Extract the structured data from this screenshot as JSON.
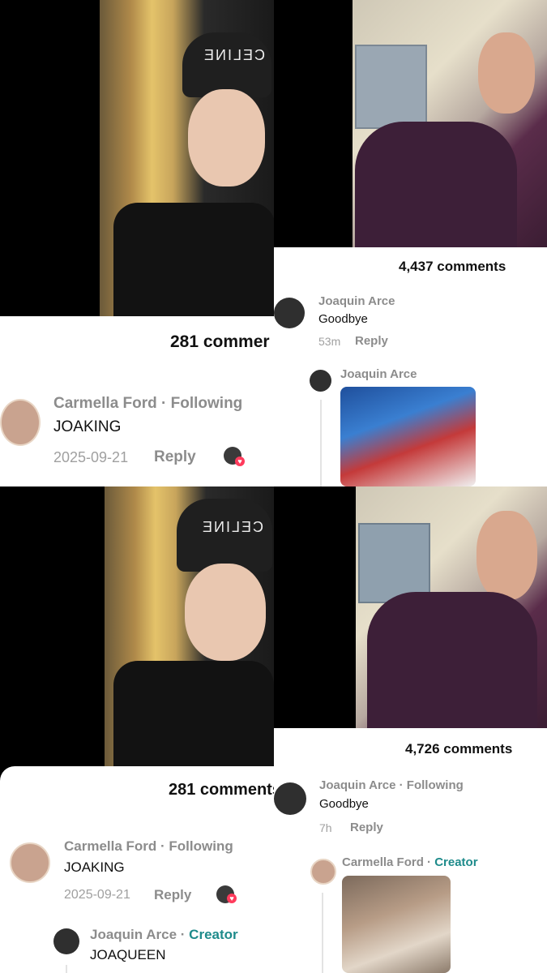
{
  "top_left": {
    "comments_count": "281 commer",
    "comment": {
      "author": "Carmella Ford · Following",
      "text": "JOAKING",
      "date": "2025-09-21",
      "reply_label": "Reply"
    }
  },
  "top_right": {
    "comments_count": "4,437 comments",
    "comment": {
      "author": "Joaquin Arce",
      "text": "Goodbye",
      "time": "53m",
      "reply_label": "Reply"
    },
    "reply_author": "Joaquin Arce"
  },
  "bottom_left": {
    "comments_count": "281 comments",
    "comment": {
      "author": "Carmella Ford · Following",
      "text": "JOAKING",
      "date": "2025-09-21",
      "reply_label": "Reply"
    },
    "reply": {
      "author": "Joaquin Arce · ",
      "badge": "Creator",
      "text": "JOAQUEEN"
    }
  },
  "bottom_right": {
    "comments_count": "4,726 comments",
    "comment": {
      "author": "Joaquin Arce · Following",
      "text": "Goodbye",
      "time": "7h",
      "reply_label": "Reply"
    },
    "reply": {
      "author": "Carmella Ford · ",
      "badge": "Creator"
    }
  },
  "icons": {
    "liked_by_creator": "heart-icon",
    "celine_cap_text": "CELINE"
  }
}
